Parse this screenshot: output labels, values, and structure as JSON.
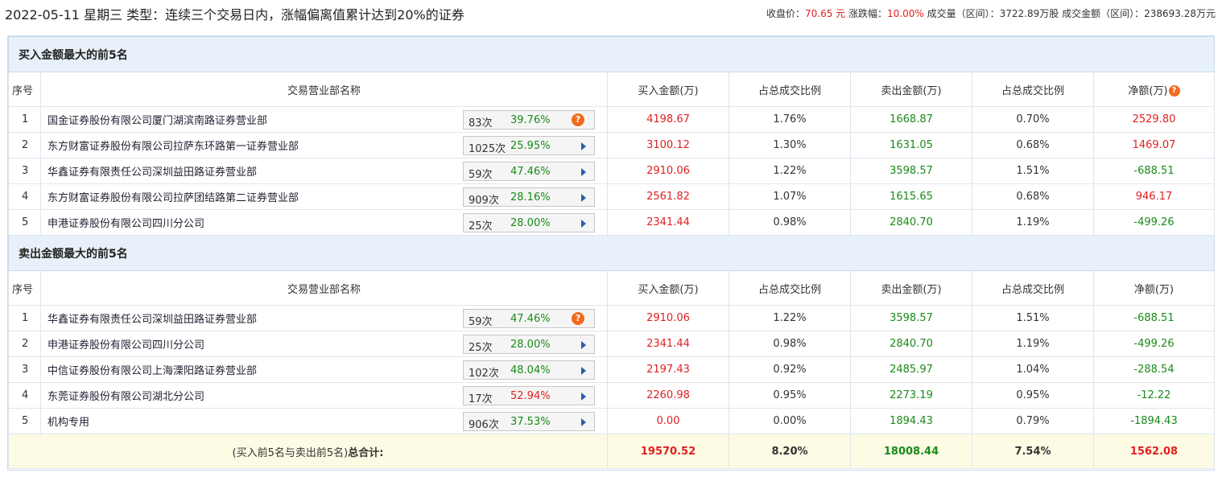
{
  "header": {
    "title": "2022-05-11 星期三 类型：连续三个交易日内，涨幅偏离值累计达到20%的证券",
    "close_label": "收盘价：",
    "close_value": "70.65 元",
    "change_label": "涨跌幅：",
    "change_value": "10.00%",
    "volume_label": "成交量（区间）：",
    "volume_value": "3722.89万股",
    "amount_label": "成交金额（区间）：",
    "amount_value": "238693.28万元"
  },
  "columns": {
    "idx": "序号",
    "name": "交易营业部名称",
    "buy": "买入金额(万)",
    "buy_pct": "占总成交比例",
    "sell": "卖出金额(万)",
    "sell_pct": "占总成交比例",
    "net": "净额(万)"
  },
  "icons": {
    "help": "question-mark-icon",
    "expand": "triangle-right-icon"
  },
  "colors": {
    "up": "#e02020",
    "down": "#1a8a1a",
    "help": "#f26b1d",
    "section_bg": "#e8f1f9",
    "total_bg": "#fdfbe4"
  },
  "buy_section": {
    "title": "买入金额最大的前5名",
    "rows": [
      {
        "idx": "1",
        "name": "国金证券股份有限公司厦门湖滨南路证券营业部",
        "count": "83次",
        "ratio": "39.76%",
        "buy": "4198.67",
        "buy_pct": "1.76%",
        "sell": "1668.87",
        "sell_pct": "0.70%",
        "net": "2529.80"
      },
      {
        "idx": "2",
        "name": "东方财富证券股份有限公司拉萨东环路第一证券营业部",
        "count": "1025次",
        "ratio": "25.95%",
        "buy": "3100.12",
        "buy_pct": "1.30%",
        "sell": "1631.05",
        "sell_pct": "0.68%",
        "net": "1469.07"
      },
      {
        "idx": "3",
        "name": "华鑫证券有限责任公司深圳益田路证券营业部",
        "count": "59次",
        "ratio": "47.46%",
        "buy": "2910.06",
        "buy_pct": "1.22%",
        "sell": "3598.57",
        "sell_pct": "1.51%",
        "net": "-688.51"
      },
      {
        "idx": "4",
        "name": "东方财富证券股份有限公司拉萨团结路第二证券营业部",
        "count": "909次",
        "ratio": "28.16%",
        "buy": "2561.82",
        "buy_pct": "1.07%",
        "sell": "1615.65",
        "sell_pct": "0.68%",
        "net": "946.17"
      },
      {
        "idx": "5",
        "name": "申港证券股份有限公司四川分公司",
        "count": "25次",
        "ratio": "28.00%",
        "buy": "2341.44",
        "buy_pct": "0.98%",
        "sell": "2840.70",
        "sell_pct": "1.19%",
        "net": "-499.26"
      }
    ]
  },
  "sell_section": {
    "title": "卖出金额最大的前5名",
    "rows": [
      {
        "idx": "1",
        "name": "华鑫证券有限责任公司深圳益田路证券营业部",
        "count": "59次",
        "ratio": "47.46%",
        "buy": "2910.06",
        "buy_pct": "1.22%",
        "sell": "3598.57",
        "sell_pct": "1.51%",
        "net": "-688.51"
      },
      {
        "idx": "2",
        "name": "申港证券股份有限公司四川分公司",
        "count": "25次",
        "ratio": "28.00%",
        "buy": "2341.44",
        "buy_pct": "0.98%",
        "sell": "2840.70",
        "sell_pct": "1.19%",
        "net": "-499.26"
      },
      {
        "idx": "3",
        "name": "中信证券股份有限公司上海溧阳路证券营业部",
        "count": "102次",
        "ratio": "48.04%",
        "buy": "2197.43",
        "buy_pct": "0.92%",
        "sell": "2485.97",
        "sell_pct": "1.04%",
        "net": "-288.54"
      },
      {
        "idx": "4",
        "name": "东莞证券股份有限公司湖北分公司",
        "count": "17次",
        "ratio": "52.94%",
        "buy": "2260.98",
        "buy_pct": "0.95%",
        "sell": "2273.19",
        "sell_pct": "0.95%",
        "net": "-12.22"
      },
      {
        "idx": "5",
        "name": "机构专用",
        "count": "906次",
        "ratio": "37.53%",
        "buy": "0.00",
        "buy_pct": "0.00%",
        "sell": "1894.43",
        "sell_pct": "0.79%",
        "net": "-1894.43"
      }
    ]
  },
  "total": {
    "label_prefix": "(买入前5名与卖出前5名)",
    "label_bold": "总合计:",
    "buy": "19570.52",
    "buy_pct": "8.20%",
    "sell": "18008.44",
    "sell_pct": "7.54%",
    "net": "1562.08"
  }
}
